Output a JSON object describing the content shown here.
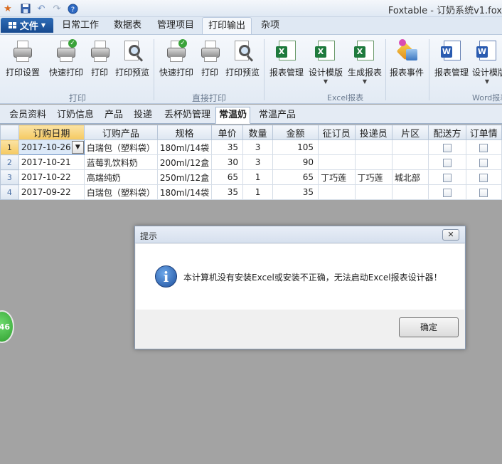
{
  "window": {
    "title": "Foxtable - 订奶系统v1.fox"
  },
  "quick_access": [
    "app-logo-icon",
    "save-icon",
    "undo-icon",
    "redo-icon",
    "help-icon"
  ],
  "menu": {
    "file_label": "文件",
    "tabs": [
      "日常工作",
      "数据表",
      "管理项目",
      "打印输出",
      "杂项"
    ],
    "active_tab": "打印输出"
  },
  "ribbon": {
    "groups": {
      "print": "打印",
      "direct_print": "直接打印",
      "excel_report": "Excel报表",
      "word_report": "Word报表"
    },
    "buttons": {
      "print_setup": "打印设置",
      "quick_print_1": "快速打印",
      "print_1": "打印",
      "print_preview_1": "打印预览",
      "quick_print_2": "快速打印",
      "print_2": "打印",
      "print_preview_2": "打印预览",
      "report_manage_1": "报表管理",
      "design_template_1": "设计模版",
      "generate_report": "生成报表",
      "report_event": "报表事件",
      "report_manage_2": "报表管理",
      "design_template_2": "设计模版"
    }
  },
  "sheet_tabs": [
    "会员资料",
    "订奶信息",
    "产品",
    "投递",
    "丢杯奶管理",
    "常温奶",
    "常温产品"
  ],
  "active_sheet": "常温奶",
  "table": {
    "columns": [
      "订购日期",
      "订购产品",
      "规格",
      "单价",
      "数量",
      "金额",
      "征订员",
      "投递员",
      "片区",
      "配送方",
      "订单情"
    ],
    "rows": [
      {
        "no": "1",
        "date": "2017-10-26",
        "product": "白瑞包（塑料袋）",
        "spec": "180ml/14袋",
        "price": "35",
        "qty": "3",
        "amount": "105",
        "collector": "",
        "deliverer": "",
        "area": ""
      },
      {
        "no": "2",
        "date": "2017-10-21",
        "product": "蓝莓乳饮料奶",
        "spec": "200ml/12盒",
        "price": "30",
        "qty": "3",
        "amount": "90",
        "collector": "",
        "deliverer": "",
        "area": ""
      },
      {
        "no": "3",
        "date": "2017-10-22",
        "product": "高端纯奶",
        "spec": "250ml/12盒",
        "price": "65",
        "qty": "1",
        "amount": "65",
        "collector": "丁巧莲",
        "deliverer": "丁巧莲",
        "area": "城北部"
      },
      {
        "no": "4",
        "date": "2017-09-22",
        "product": "白瑞包（塑料袋）",
        "spec": "180ml/14袋",
        "price": "35",
        "qty": "1",
        "amount": "35",
        "collector": "",
        "deliverer": "",
        "area": ""
      }
    ]
  },
  "side_badge": "46",
  "dialog": {
    "title": "提示",
    "message": "本计算机没有安装Excel或安装不正确，无法启动Excel报表设计器！",
    "ok_label": "确定",
    "close_glyph": "✕"
  }
}
